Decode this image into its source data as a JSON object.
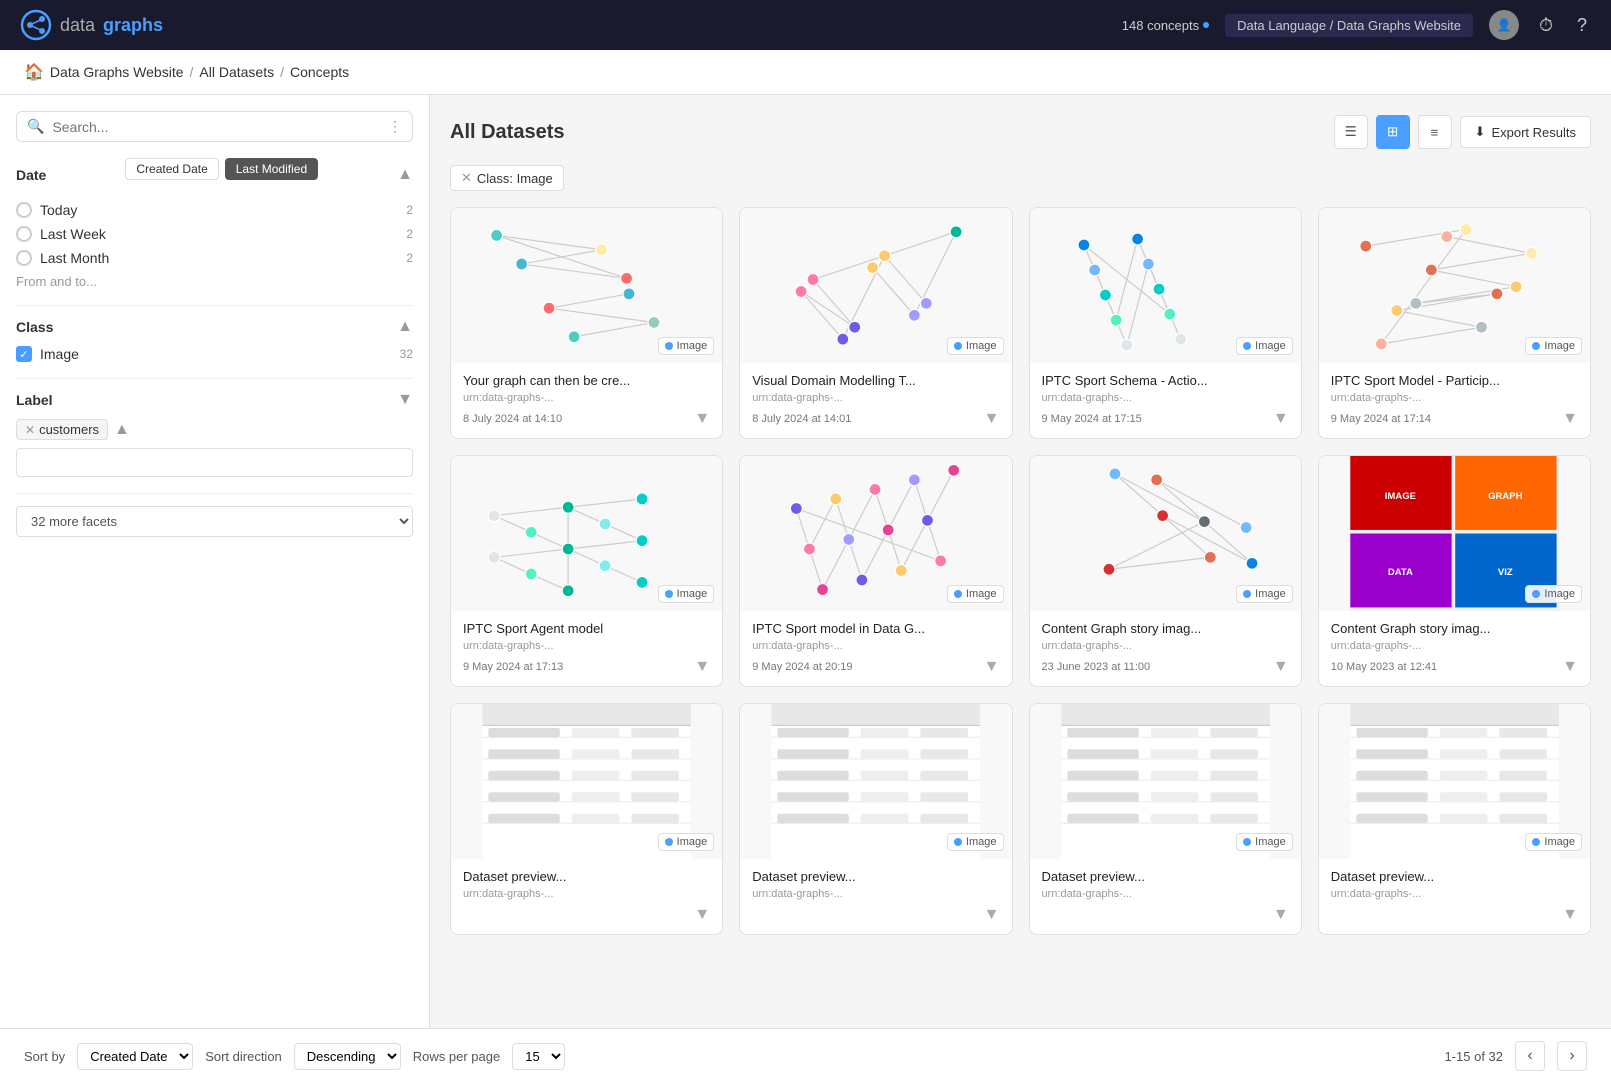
{
  "header": {
    "logo_data": "datagraphs",
    "logo_data_part": "data",
    "logo_graphs_part": "graphs",
    "concepts_count": "148 concepts",
    "path": "Data Language / Data Graphs Website",
    "history_icon": "⏱",
    "help_icon": "?"
  },
  "breadcrumb": {
    "home_label": "Data Graphs Website",
    "datasets_label": "All Datasets",
    "current_label": "Concepts"
  },
  "sidebar": {
    "search_placeholder": "Search...",
    "date_section": {
      "title": "Date",
      "tabs": [
        {
          "label": "Created Date",
          "active": false
        },
        {
          "label": "Last Modified",
          "active": true
        }
      ],
      "options": [
        {
          "label": "Today",
          "count": "2"
        },
        {
          "label": "Last Week",
          "count": "2"
        },
        {
          "label": "Last Month",
          "count": "2"
        }
      ],
      "from_to_label": "From and to..."
    },
    "class_section": {
      "title": "Class",
      "items": [
        {
          "label": "Image",
          "count": "32",
          "checked": true
        }
      ]
    },
    "label_section": {
      "title": "Label",
      "active_tag": "customers",
      "input_placeholder": ""
    },
    "more_facets": {
      "label": "32 more facets"
    }
  },
  "main": {
    "title": "All Datasets",
    "active_filter": "Class: Image",
    "export_label": "Export Results",
    "cards": [
      {
        "title": "Your graph can then be cre...",
        "urn": "urn:data-graphs-...",
        "date": "8 July 2024 at 14:10",
        "badge": "Image",
        "color": "#e8f4ff"
      },
      {
        "title": "Visual Domain Modelling T...",
        "urn": "urn:data-graphs-...",
        "date": "8 July 2024 at 14:01",
        "badge": "Image",
        "color": "#fff8e8"
      },
      {
        "title": "IPTC Sport Schema - Actio...",
        "urn": "urn:data-graphs-...",
        "date": "9 May 2024 at 17:15",
        "badge": "Image",
        "color": "#f0f0ff"
      },
      {
        "title": "IPTC Sport Model - Particip...",
        "urn": "urn:data-graphs-...",
        "date": "9 May 2024 at 17:14",
        "badge": "Image",
        "color": "#fff0f8"
      },
      {
        "title": "IPTC Sport Agent model",
        "urn": "urn:data-graphs-...",
        "date": "9 May 2024 at 17:13",
        "badge": "Image",
        "color": "#f0fff0"
      },
      {
        "title": "IPTC Sport model in Data G...",
        "urn": "urn:data-graphs-...",
        "date": "9 May 2024 at 20:19",
        "badge": "Image",
        "color": "#fff8f0"
      },
      {
        "title": "Content Graph story imag...",
        "urn": "urn:data-graphs-...",
        "date": "23 June 2023 at 11:00",
        "badge": "Image",
        "color": "#f8f0ff"
      },
      {
        "title": "Content Graph story imag...",
        "urn": "urn:data-graphs-...",
        "date": "10 May 2023 at 12:41",
        "badge": "Image",
        "color": "#fff0e8"
      },
      {
        "title": "Dataset preview...",
        "urn": "urn:data-graphs-...",
        "date": "",
        "badge": "Image",
        "color": "#f5f5f5"
      },
      {
        "title": "Dataset preview...",
        "urn": "urn:data-graphs-...",
        "date": "",
        "badge": "Image",
        "color": "#f5f5f5"
      },
      {
        "title": "Dataset preview...",
        "urn": "urn:data-graphs-...",
        "date": "",
        "badge": "Image",
        "color": "#f5f5f5"
      },
      {
        "title": "Dataset preview...",
        "urn": "urn:data-graphs-...",
        "date": "",
        "badge": "Image",
        "color": "#f5f5f5"
      }
    ]
  },
  "pagination": {
    "sort_by_label": "Sort by",
    "sort_field": "Created Date",
    "direction_label": "Sort direction",
    "direction": "Descending",
    "rows_label": "Rows per page",
    "rows": "15",
    "range": "1-15 of 32",
    "prev_icon": "‹",
    "next_icon": "›"
  }
}
